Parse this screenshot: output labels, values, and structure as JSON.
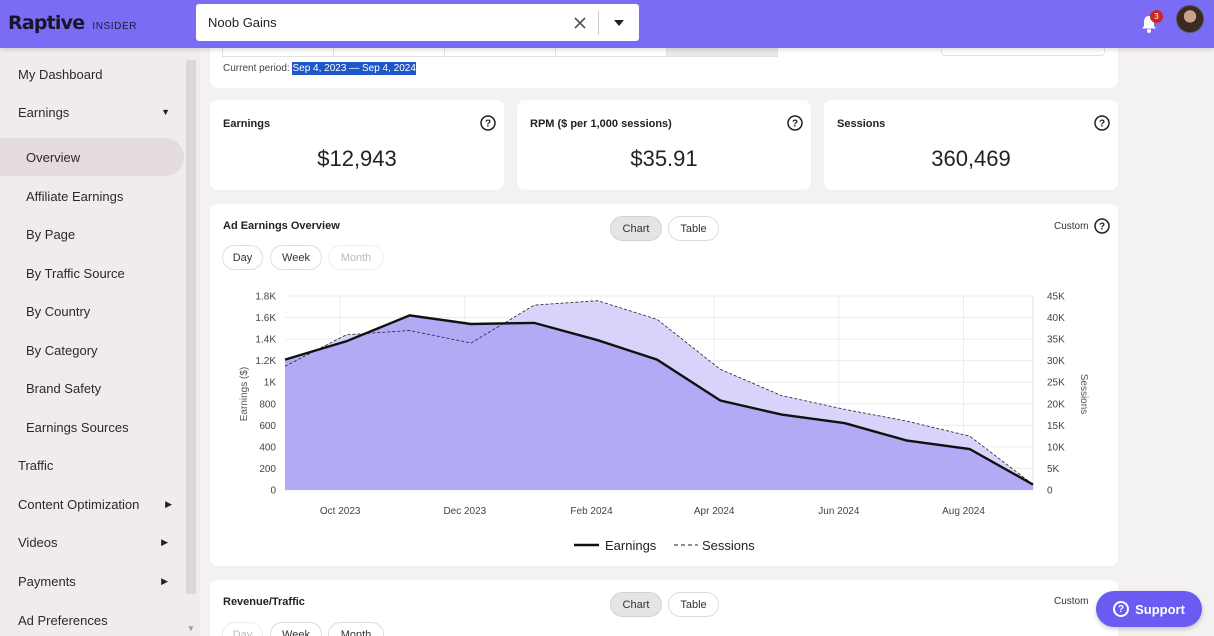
{
  "header": {
    "logo_text": "Raptive",
    "logo_sub": "INSIDER",
    "site_selector_value": "Noob Gains",
    "notification_count": "3"
  },
  "sidebar": {
    "items": [
      {
        "label": "My Dashboard"
      },
      {
        "label": "Earnings"
      },
      {
        "label": "Overview"
      },
      {
        "label": "Affiliate Earnings"
      },
      {
        "label": "By Page"
      },
      {
        "label": "By Traffic Source"
      },
      {
        "label": "By Country"
      },
      {
        "label": "By Category"
      },
      {
        "label": "Brand Safety"
      },
      {
        "label": "Earnings Sources"
      },
      {
        "label": "Traffic"
      },
      {
        "label": "Content Optimization"
      },
      {
        "label": "Videos"
      },
      {
        "label": "Payments"
      },
      {
        "label": "Ad Preferences"
      }
    ]
  },
  "period": {
    "prefix": "Current period:",
    "range": "Sep 4, 2023 — Sep 4, 2024"
  },
  "metrics": [
    {
      "title": "Earnings",
      "value": "$12,943"
    },
    {
      "title": "RPM ($ per 1,000 sessions)",
      "value": "$35.91"
    },
    {
      "title": "Sessions",
      "value": "360,469"
    }
  ],
  "ad_overview": {
    "title": "Ad Earnings Overview",
    "view_tabs": [
      "Chart",
      "Table"
    ],
    "granularity": [
      "Day",
      "Week",
      "Month"
    ],
    "custom_label": "Custom"
  },
  "revenue_traffic": {
    "title": "Revenue/Traffic",
    "view_tabs": [
      "Chart",
      "Table"
    ],
    "granularity": [
      "Day",
      "Week",
      "Month"
    ],
    "custom_label": "Custom"
  },
  "support_label": "Support",
  "colors": {
    "brand": "#7b6cf6",
    "earnings_fill": "#b3aaf6",
    "sessions_fill": "#d8d3fb",
    "earnings_line": "#111111"
  },
  "chart_data": {
    "type": "area",
    "ylabel": "Earnings ($)",
    "y2label": "Sessions",
    "ylim": [
      0,
      1800
    ],
    "y2lim": [
      0,
      45000
    ],
    "y_ticks": [
      "0",
      "200",
      "400",
      "600",
      "800",
      "1K",
      "1.2K",
      "1.4K",
      "1.6K",
      "1.8K"
    ],
    "y2_ticks": [
      "0",
      "5K",
      "10K",
      "15K",
      "20K",
      "25K",
      "30K",
      "35K",
      "40K",
      "45K"
    ],
    "x_ticks": [
      "Oct 2023",
      "Dec 2023",
      "Feb 2024",
      "Apr 2024",
      "Jun 2024",
      "Aug 2024"
    ],
    "x": [
      "2023-09-04",
      "2023-10-04",
      "2023-11-04",
      "2023-12-04",
      "2024-01-04",
      "2024-02-04",
      "2024-03-04",
      "2024-04-04",
      "2024-05-04",
      "2024-06-04",
      "2024-07-04",
      "2024-08-04",
      "2024-09-04"
    ],
    "series": [
      {
        "name": "Earnings",
        "axis": "left",
        "values": [
          1210,
          1380,
          1620,
          1540,
          1550,
          1390,
          1210,
          830,
          700,
          620,
          460,
          380,
          50
        ]
      },
      {
        "name": "Sessions",
        "axis": "right",
        "values": [
          28700,
          36000,
          37000,
          34100,
          42900,
          43900,
          39600,
          28000,
          21900,
          18700,
          16000,
          12500,
          1300
        ]
      }
    ],
    "legend_position": "bottom",
    "grid": true
  }
}
